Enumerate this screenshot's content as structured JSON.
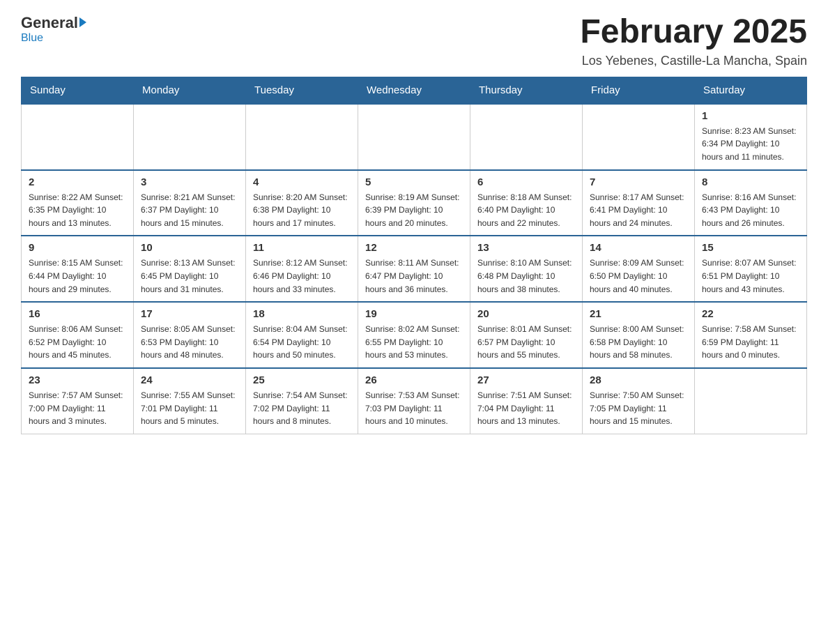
{
  "header": {
    "logo_general": "General",
    "logo_blue": "Blue",
    "month_title": "February 2025",
    "location": "Los Yebenes, Castille-La Mancha, Spain"
  },
  "weekdays": [
    "Sunday",
    "Monday",
    "Tuesday",
    "Wednesday",
    "Thursday",
    "Friday",
    "Saturday"
  ],
  "weeks": [
    [
      {
        "day": "",
        "info": ""
      },
      {
        "day": "",
        "info": ""
      },
      {
        "day": "",
        "info": ""
      },
      {
        "day": "",
        "info": ""
      },
      {
        "day": "",
        "info": ""
      },
      {
        "day": "",
        "info": ""
      },
      {
        "day": "1",
        "info": "Sunrise: 8:23 AM\nSunset: 6:34 PM\nDaylight: 10 hours and 11 minutes."
      }
    ],
    [
      {
        "day": "2",
        "info": "Sunrise: 8:22 AM\nSunset: 6:35 PM\nDaylight: 10 hours and 13 minutes."
      },
      {
        "day": "3",
        "info": "Sunrise: 8:21 AM\nSunset: 6:37 PM\nDaylight: 10 hours and 15 minutes."
      },
      {
        "day": "4",
        "info": "Sunrise: 8:20 AM\nSunset: 6:38 PM\nDaylight: 10 hours and 17 minutes."
      },
      {
        "day": "5",
        "info": "Sunrise: 8:19 AM\nSunset: 6:39 PM\nDaylight: 10 hours and 20 minutes."
      },
      {
        "day": "6",
        "info": "Sunrise: 8:18 AM\nSunset: 6:40 PM\nDaylight: 10 hours and 22 minutes."
      },
      {
        "day": "7",
        "info": "Sunrise: 8:17 AM\nSunset: 6:41 PM\nDaylight: 10 hours and 24 minutes."
      },
      {
        "day": "8",
        "info": "Sunrise: 8:16 AM\nSunset: 6:43 PM\nDaylight: 10 hours and 26 minutes."
      }
    ],
    [
      {
        "day": "9",
        "info": "Sunrise: 8:15 AM\nSunset: 6:44 PM\nDaylight: 10 hours and 29 minutes."
      },
      {
        "day": "10",
        "info": "Sunrise: 8:13 AM\nSunset: 6:45 PM\nDaylight: 10 hours and 31 minutes."
      },
      {
        "day": "11",
        "info": "Sunrise: 8:12 AM\nSunset: 6:46 PM\nDaylight: 10 hours and 33 minutes."
      },
      {
        "day": "12",
        "info": "Sunrise: 8:11 AM\nSunset: 6:47 PM\nDaylight: 10 hours and 36 minutes."
      },
      {
        "day": "13",
        "info": "Sunrise: 8:10 AM\nSunset: 6:48 PM\nDaylight: 10 hours and 38 minutes."
      },
      {
        "day": "14",
        "info": "Sunrise: 8:09 AM\nSunset: 6:50 PM\nDaylight: 10 hours and 40 minutes."
      },
      {
        "day": "15",
        "info": "Sunrise: 8:07 AM\nSunset: 6:51 PM\nDaylight: 10 hours and 43 minutes."
      }
    ],
    [
      {
        "day": "16",
        "info": "Sunrise: 8:06 AM\nSunset: 6:52 PM\nDaylight: 10 hours and 45 minutes."
      },
      {
        "day": "17",
        "info": "Sunrise: 8:05 AM\nSunset: 6:53 PM\nDaylight: 10 hours and 48 minutes."
      },
      {
        "day": "18",
        "info": "Sunrise: 8:04 AM\nSunset: 6:54 PM\nDaylight: 10 hours and 50 minutes."
      },
      {
        "day": "19",
        "info": "Sunrise: 8:02 AM\nSunset: 6:55 PM\nDaylight: 10 hours and 53 minutes."
      },
      {
        "day": "20",
        "info": "Sunrise: 8:01 AM\nSunset: 6:57 PM\nDaylight: 10 hours and 55 minutes."
      },
      {
        "day": "21",
        "info": "Sunrise: 8:00 AM\nSunset: 6:58 PM\nDaylight: 10 hours and 58 minutes."
      },
      {
        "day": "22",
        "info": "Sunrise: 7:58 AM\nSunset: 6:59 PM\nDaylight: 11 hours and 0 minutes."
      }
    ],
    [
      {
        "day": "23",
        "info": "Sunrise: 7:57 AM\nSunset: 7:00 PM\nDaylight: 11 hours and 3 minutes."
      },
      {
        "day": "24",
        "info": "Sunrise: 7:55 AM\nSunset: 7:01 PM\nDaylight: 11 hours and 5 minutes."
      },
      {
        "day": "25",
        "info": "Sunrise: 7:54 AM\nSunset: 7:02 PM\nDaylight: 11 hours and 8 minutes."
      },
      {
        "day": "26",
        "info": "Sunrise: 7:53 AM\nSunset: 7:03 PM\nDaylight: 11 hours and 10 minutes."
      },
      {
        "day": "27",
        "info": "Sunrise: 7:51 AM\nSunset: 7:04 PM\nDaylight: 11 hours and 13 minutes."
      },
      {
        "day": "28",
        "info": "Sunrise: 7:50 AM\nSunset: 7:05 PM\nDaylight: 11 hours and 15 minutes."
      },
      {
        "day": "",
        "info": ""
      }
    ]
  ]
}
